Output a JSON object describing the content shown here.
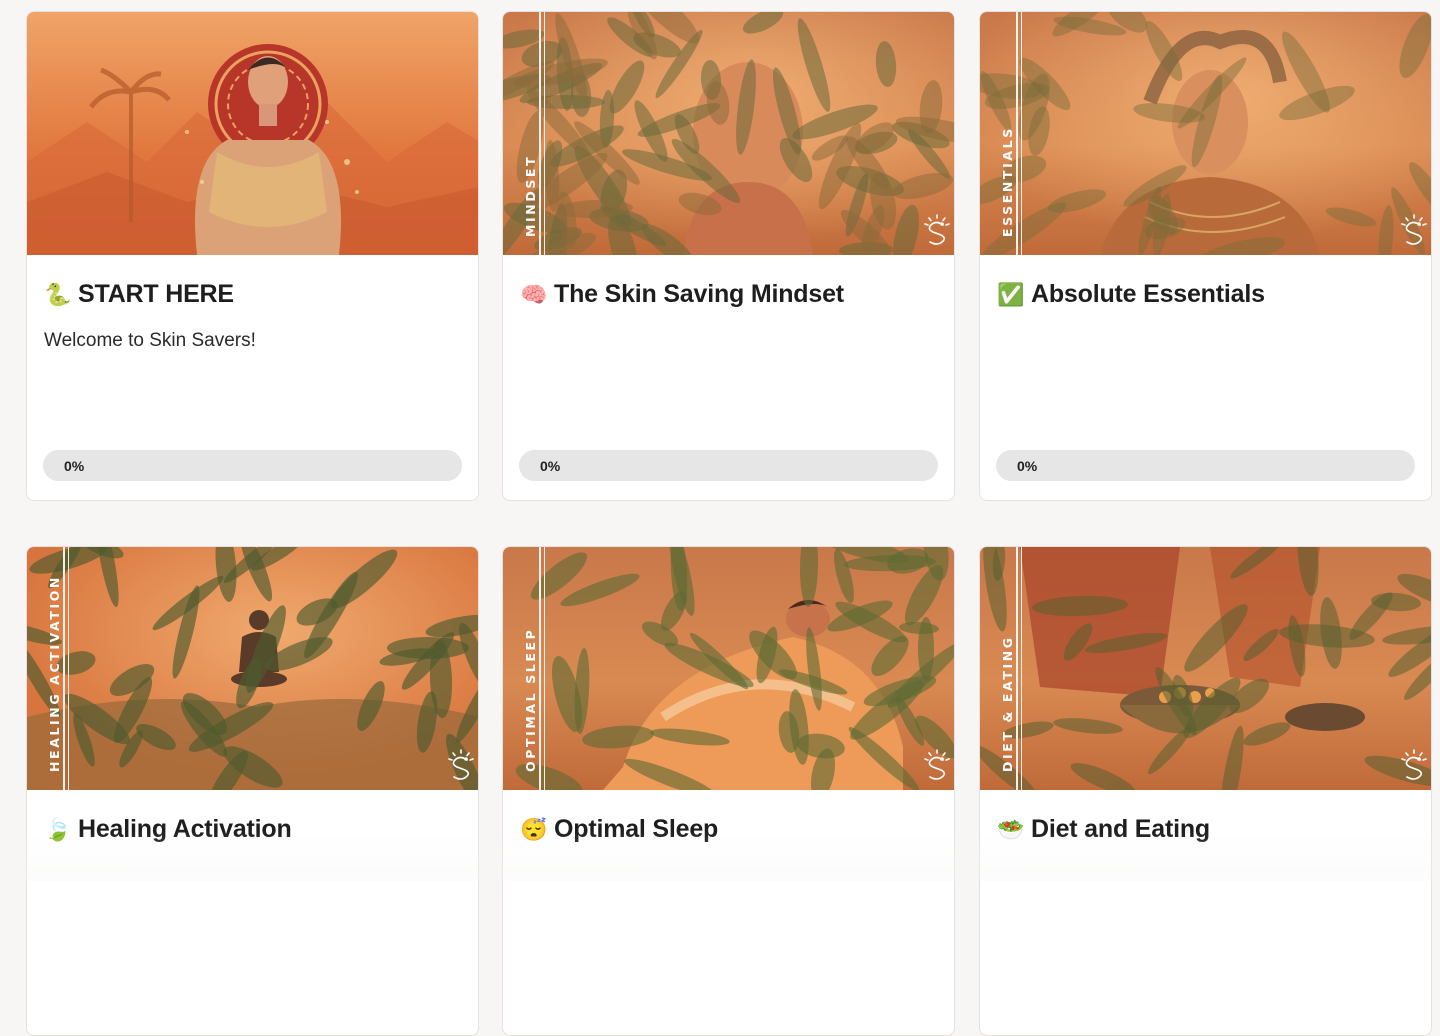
{
  "cards": [
    {
      "emoji": "🐍",
      "title": "START HERE",
      "description": "Welcome to Skin Savers!",
      "progress_text": "0%",
      "progress": 0,
      "side_label": "",
      "scene": "man-halo",
      "show_progress": true
    },
    {
      "emoji": "🧠",
      "title": "The Skin Saving Mindset",
      "description": "",
      "progress_text": "0%",
      "progress": 0,
      "side_label": "MINDSET",
      "scene": "face-leaves",
      "show_progress": true
    },
    {
      "emoji": "✅",
      "title": "Absolute Essentials",
      "description": "",
      "progress_text": "0%",
      "progress": 0,
      "side_label": "ESSENTIALS",
      "scene": "headdress",
      "show_progress": true
    },
    {
      "emoji": "🍃",
      "title": "Healing Activation",
      "description": "",
      "progress_text": "",
      "progress": 0,
      "side_label": "HEALING ACTIVATION",
      "scene": "meditation",
      "show_progress": false
    },
    {
      "emoji": "😴",
      "title": "Optimal Sleep",
      "description": "",
      "progress_text": "",
      "progress": 0,
      "side_label": "OPTIMAL SLEEP",
      "scene": "sleeping",
      "show_progress": false
    },
    {
      "emoji": "🥗",
      "title": "Diet and Eating",
      "description": "",
      "progress_text": "",
      "progress": 0,
      "side_label": "DIET & EATING",
      "scene": "bowl",
      "show_progress": false
    }
  ],
  "colors": {
    "orange_light": "#f0a060",
    "orange_mid": "#d9733a",
    "orange_dark": "#a9502a",
    "leaf_green": "#6a6a3a",
    "progress_fill": "#2e2e2e"
  },
  "icons": {
    "logo": "snake-sun-logo-icon"
  }
}
